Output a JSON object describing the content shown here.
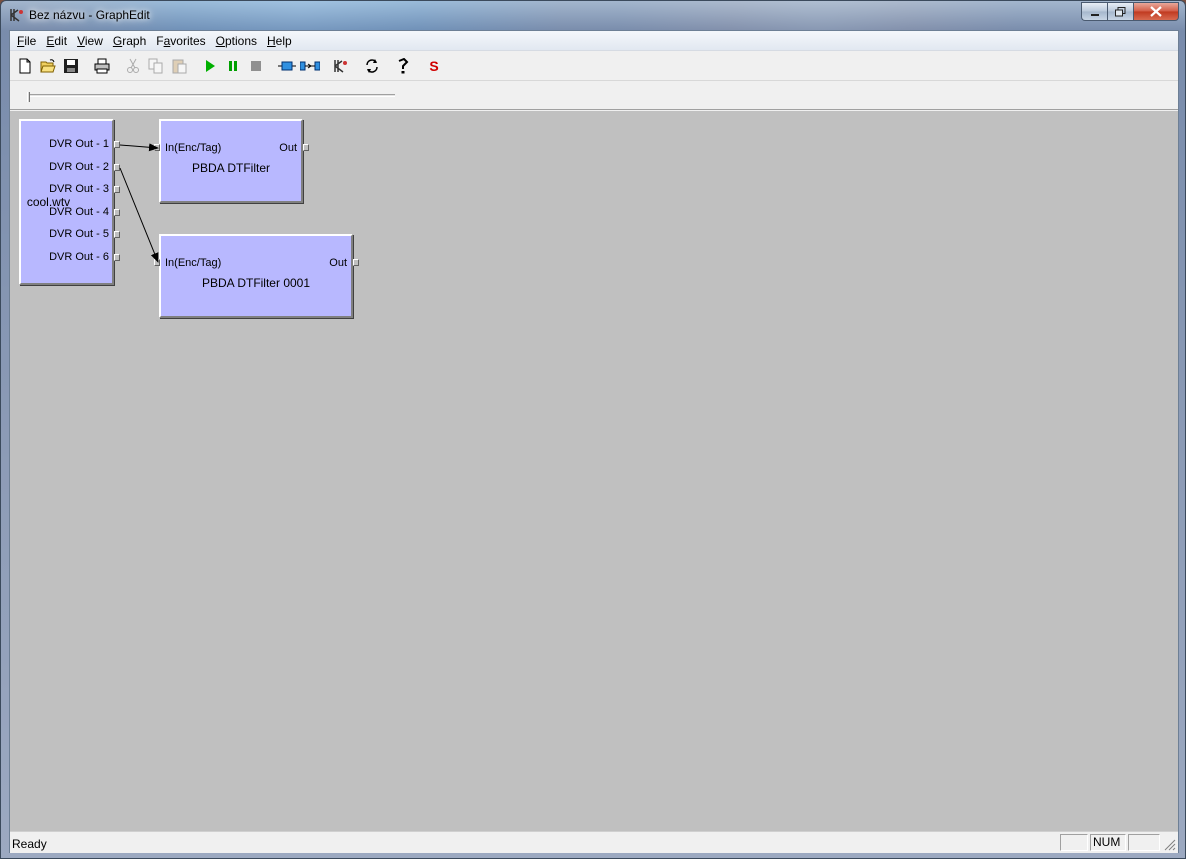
{
  "window": {
    "title": "Bez názvu - GraphEdit",
    "minimize_label": "–",
    "maximize_label": "□",
    "close_label": "✕"
  },
  "menu": [
    {
      "hot": "F",
      "rest": "ile"
    },
    {
      "hot": "E",
      "rest": "dit"
    },
    {
      "hot": "V",
      "rest": "iew"
    },
    {
      "hot": "G",
      "rest": "raph"
    },
    {
      "hot": "",
      "pre": "F",
      "hot2": "a",
      "rest": "vorites"
    },
    {
      "hot": "O",
      "rest": "ptions"
    },
    {
      "hot": "H",
      "rest": "elp"
    }
  ],
  "toolbar": {
    "icons": [
      "new-icon",
      "open-icon",
      "save-icon",
      "print-icon",
      "cut-icon",
      "copy-icon",
      "paste-icon",
      "play-icon",
      "pause-icon",
      "stop-icon",
      "insert-filter-icon",
      "connect-icon",
      "graphedit-icon",
      "refresh-icon",
      "help-icon",
      "s-icon"
    ],
    "s_label": "S",
    "help_label": "?"
  },
  "graph": {
    "source_filter": {
      "name": "cool.wtv",
      "pins": [
        "DVR Out - 1",
        "DVR Out - 2",
        "DVR Out - 3",
        "DVR Out - 4",
        "DVR Out - 5",
        "DVR Out - 6"
      ]
    },
    "filter1": {
      "name": "PBDA DTFilter",
      "in_pin": "In(Enc/Tag)",
      "out_pin": "Out"
    },
    "filter2": {
      "name": "PBDA DTFilter 0001",
      "in_pin": "In(Enc/Tag)",
      "out_pin": "Out"
    }
  },
  "status": {
    "text": "Ready",
    "num": "NUM"
  },
  "colors": {
    "filter_fill": "#b8b8ff",
    "canvas": "#c0c0c0"
  }
}
